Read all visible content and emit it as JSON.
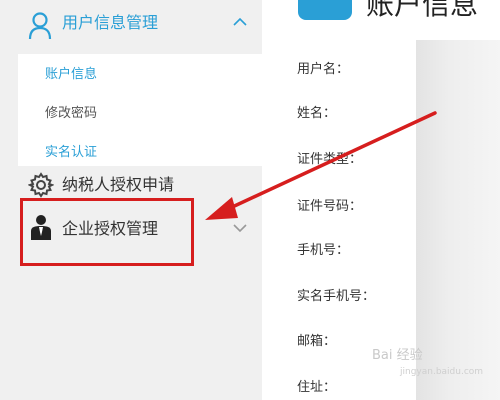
{
  "sidebar": {
    "group": {
      "label": "用户信息管理",
      "icon": "user-icon",
      "expanded_icon": "chevron-up-icon"
    },
    "sub_items": [
      {
        "label": "账户信息",
        "active": true
      },
      {
        "label": "修改密码",
        "active": false
      },
      {
        "label": "实名认证",
        "active": false
      }
    ],
    "nav_items": [
      {
        "label": "纳税人授权申请",
        "icon": "gear-icon"
      },
      {
        "label": "企业授权管理",
        "icon": "business-user-icon",
        "expand_icon": "chevron-down-icon"
      }
    ]
  },
  "main": {
    "title": "账户信息",
    "fields": [
      {
        "label": "用户名："
      },
      {
        "label": "姓名："
      },
      {
        "label": "证件类型："
      },
      {
        "label": "证件号码："
      },
      {
        "label": "手机号："
      },
      {
        "label": "实名手机号："
      },
      {
        "label": "邮箱："
      },
      {
        "label": "住址："
      }
    ]
  },
  "watermark": {
    "text": "Bai 经验",
    "sub": "jingyan.baidu.com"
  },
  "colors": {
    "accent": "#2a9fd6",
    "highlight": "#d61e1e",
    "sidebar_bg": "#f0f0f0"
  }
}
